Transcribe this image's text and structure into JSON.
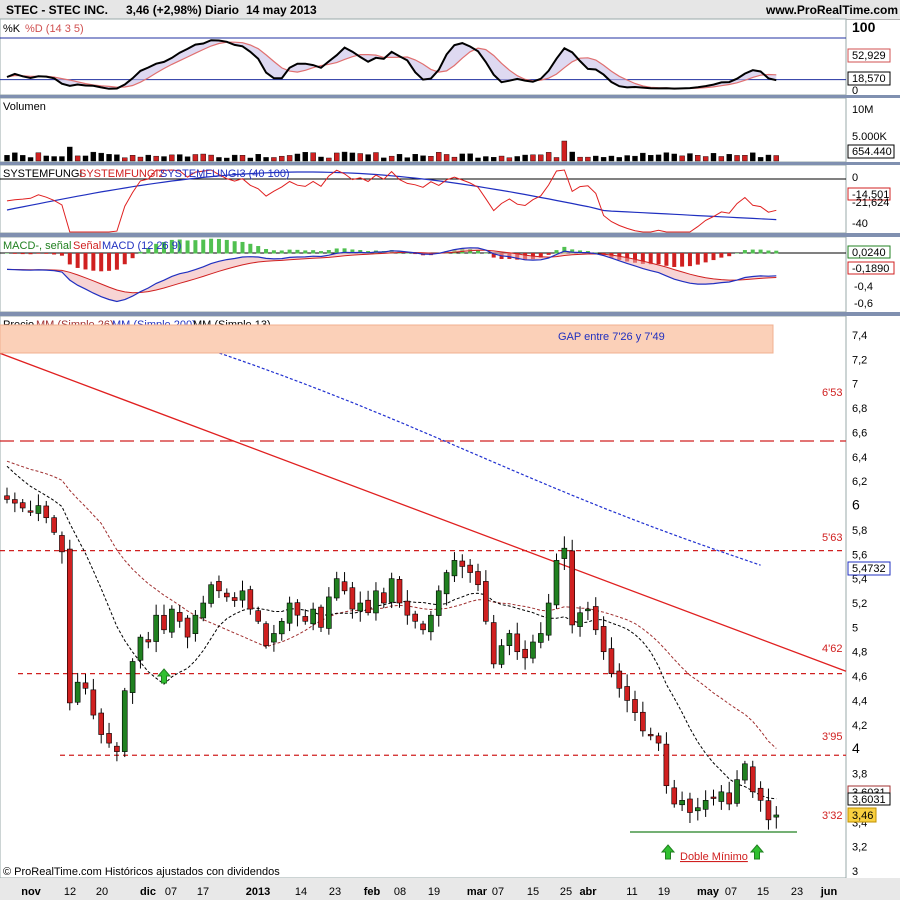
{
  "header": {
    "ticker": "STEC - STEC INC.",
    "last": "3,46 (+2,98%)",
    "period": "Diario",
    "date": "14 may 2013",
    "site": "www.ProRealTime.com"
  },
  "footer": "© ProRealTime.com Históricos ajustados con dividendos",
  "panels": {
    "stoch": {
      "title_k": "%K",
      "title_d": "%D (14 3 5)",
      "levels": [
        "100",
        "52,929",
        "18,570",
        "0"
      ]
    },
    "volume": {
      "title": "Volumen",
      "levels": [
        "10M",
        "5.000K",
        "654.440"
      ]
    },
    "systemfungi": {
      "title_1": "SYSTEMFUNGI",
      "title_2": "SYSTEMFUNGI2",
      "title_3": "SYSTEMFUNGI3 (40 100)",
      "levels": [
        "0",
        "-14,501",
        "-21,624",
        "-40"
      ]
    },
    "macd": {
      "title_1": "MACD-, señal",
      "title_2": "Señal",
      "title_3": "MACD (12 26 9)",
      "levels": [
        "0,0240",
        "-0,1890",
        "-0,4",
        "-0,6"
      ]
    },
    "price": {
      "title_1": "Precio",
      "title_2": "MM (Simple 26)",
      "title_3": "MM (Simple 200)",
      "title_4": "MM (Simple 13)",
      "gap_label": "GAP entre 7'26 y 7'49",
      "support_labels": [
        "6'53",
        "5'63",
        "4'62",
        "3'95",
        "3'32"
      ],
      "pattern_label": "Doble Mínimo",
      "last_values": [
        "3,6031",
        "3,46",
        "5,4732"
      ]
    }
  },
  "colors": {
    "k_line": "#000000",
    "d_line": "#e07070",
    "sf1": "#000000",
    "sf2": "#e02020",
    "sf3": "#2030c0",
    "ma26": "#a03030",
    "ma200": "#2030d0",
    "ma13": "#000000",
    "bull": "#208020",
    "bear": "#d02020",
    "gap_fill": "#fbd0b8",
    "trend": "#e02020"
  },
  "chart_data": {
    "type": "candlestick",
    "x_ticks": [
      "nov",
      "12",
      "20",
      "dic",
      "07",
      "17",
      "2013",
      "14",
      "23",
      "feb",
      "08",
      "19",
      "mar",
      "07",
      "15",
      "25",
      "abr",
      "11",
      "19",
      "may",
      "07",
      "15",
      "23",
      "jun"
    ],
    "y_ticks": [
      "7,4",
      "7,2",
      "7",
      "6,8",
      "6,6",
      "6,4",
      "6,2",
      "6",
      "5,8",
      "5,6",
      "5,4",
      "5,2",
      "5",
      "4,8",
      "4,6",
      "4,4",
      "4,2",
      "4",
      "3,8",
      "3,6",
      "3,4",
      "3,2",
      "3"
    ],
    "ylim": [
      3.0,
      7.6
    ],
    "close": [
      6.05,
      6.02,
      5.98,
      5.95,
      6.0,
      5.9,
      5.78,
      5.62,
      4.38,
      4.55,
      4.5,
      4.28,
      4.12,
      4.05,
      3.98,
      4.48,
      4.72,
      4.92,
      4.88,
      5.1,
      4.98,
      5.15,
      5.05,
      4.92,
      5.1,
      5.2,
      5.35,
      5.3,
      5.25,
      5.22,
      5.3,
      5.15,
      5.05,
      4.85,
      4.95,
      5.05,
      5.2,
      5.1,
      5.05,
      5.15,
      5.0,
      5.25,
      5.4,
      5.3,
      5.15,
      5.2,
      5.12,
      5.3,
      5.2,
      5.4,
      5.2,
      5.1,
      5.05,
      4.98,
      5.1,
      5.3,
      5.45,
      5.55,
      5.5,
      5.45,
      5.35,
      5.05,
      4.7,
      4.85,
      4.95,
      4.8,
      4.75,
      4.88,
      4.95,
      5.2,
      5.55,
      5.65,
      5.02,
      5.12,
      5.15,
      4.98,
      4.8,
      4.62,
      4.5,
      4.4,
      4.3,
      4.15,
      4.12,
      4.05,
      3.7,
      3.55,
      3.58,
      3.48,
      3.52,
      3.58,
      3.6,
      3.65,
      3.55,
      3.75,
      3.88,
      3.65,
      3.58,
      3.42,
      3.46
    ]
  }
}
